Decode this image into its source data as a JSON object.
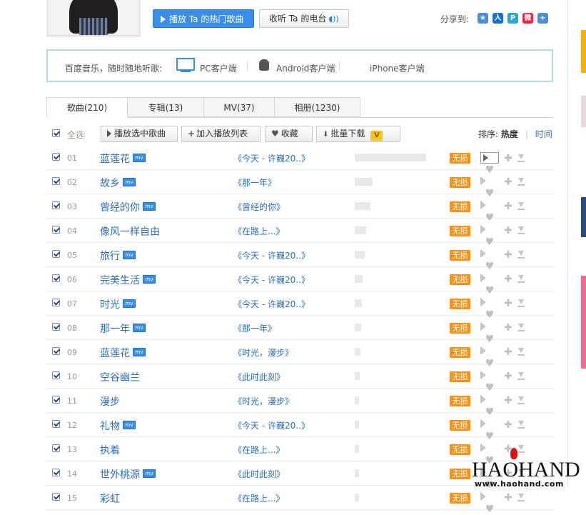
{
  "header": {
    "play_hot_label": "播放 Ta 的热门歌曲",
    "radio_label": "收听 Ta 的电台",
    "share_label": "分享到:"
  },
  "client_bar": {
    "intro": "百度音乐，随时随地听歌:",
    "pc": "PC客户端",
    "android": "Android客户端",
    "iphone": "iPhone客户端"
  },
  "tabs": [
    {
      "label": "歌曲(210)",
      "active": true
    },
    {
      "label": "专辑(13)",
      "active": false
    },
    {
      "label": "MV(37)",
      "active": false
    },
    {
      "label": "相册(1230)",
      "active": false
    }
  ],
  "toolbar": {
    "select_all": "全选",
    "play_selected": "播放选中歌曲",
    "add_to_list": "加入播放列表",
    "favorite": "收藏",
    "batch_download": "批量下载",
    "vip_badge": "V",
    "sort_label": "排序:",
    "sort_hot": "热度",
    "sort_time": "时间"
  },
  "lossless_label": "无损",
  "songs": [
    {
      "num": "01",
      "name": "蓝莲花",
      "mv": true,
      "album": "《今天 - 许巍20..》",
      "popularity": 1.0
    },
    {
      "num": "02",
      "name": "故乡",
      "mv": true,
      "album": "《那一年》",
      "popularity": 0.25
    },
    {
      "num": "03",
      "name": "曾经的你",
      "mv": true,
      "album": "《曾经的你》",
      "popularity": 0.22
    },
    {
      "num": "04",
      "name": "像风一样自由",
      "mv": false,
      "album": "《在路上...》",
      "popularity": 0.16
    },
    {
      "num": "05",
      "name": "旅行",
      "mv": true,
      "album": "《今天 - 许巍20..》",
      "popularity": 0.14
    },
    {
      "num": "06",
      "name": "完美生活",
      "mv": true,
      "album": "《今天 - 许巍20..》",
      "popularity": 0.11
    },
    {
      "num": "07",
      "name": "时光",
      "mv": true,
      "album": "《今天 - 许巍20..》",
      "popularity": 0.1
    },
    {
      "num": "08",
      "name": "那一年",
      "mv": true,
      "album": "《那一年》",
      "popularity": 0.09
    },
    {
      "num": "09",
      "name": "蓝莲花",
      "mv": true,
      "album": "《时光，漫步》",
      "popularity": 0.08
    },
    {
      "num": "10",
      "name": "空谷幽兰",
      "mv": false,
      "album": "《此时此刻》",
      "popularity": 0.07
    },
    {
      "num": "11",
      "name": "漫步",
      "mv": false,
      "album": "《时光，漫步》",
      "popularity": 0.06
    },
    {
      "num": "12",
      "name": "礼物",
      "mv": true,
      "album": "《今天 - 许巍20..》",
      "popularity": 0.06
    },
    {
      "num": "13",
      "name": "执着",
      "mv": false,
      "album": "《在路上...》",
      "popularity": 0.05
    },
    {
      "num": "14",
      "name": "世外桃源",
      "mv": true,
      "album": "《此时此刻》",
      "popularity": 0.05
    },
    {
      "num": "15",
      "name": "彩虹",
      "mv": false,
      "album": "《在路上...》",
      "popularity": 0.05
    }
  ],
  "watermark": {
    "brand": "HAOHAND",
    "url": "www.haohand.com"
  }
}
